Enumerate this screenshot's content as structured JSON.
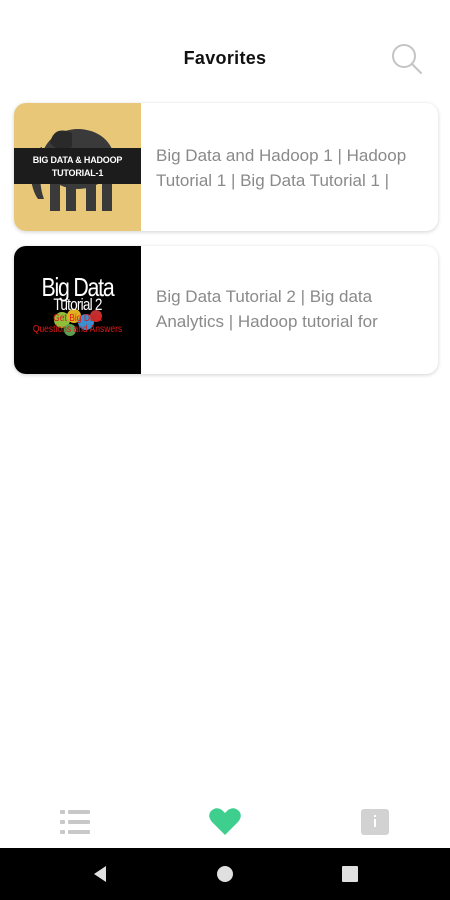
{
  "header": {
    "title": "Favorites",
    "search_icon": "search-icon"
  },
  "favorites": [
    {
      "title": "Big Data and Hadoop 1 | Hadoop Tutorial 1 | Big Data Tutorial 1 |",
      "thumbnail": {
        "line1": "BIG DATA & HADOOP",
        "line2": "TUTORIAL-1"
      }
    },
    {
      "title": "Big Data Tutorial 2 | Big data Analytics | Hadoop tutorial for",
      "thumbnail": {
        "line1": "Big Data",
        "line2": "Tutorial 2",
        "line3": "Get Big Data",
        "line4": "Questions and Answers"
      }
    }
  ],
  "tabbar": {
    "items": [
      {
        "icon": "list-icon",
        "active": false
      },
      {
        "icon": "heart-icon",
        "active": true
      },
      {
        "icon": "info-icon",
        "active": false
      }
    ],
    "active_color": "#3ecf8e",
    "inactive_color": "#c8c8c8"
  },
  "system_nav": {
    "buttons": [
      "back-icon",
      "home-icon",
      "recents-icon"
    ]
  }
}
